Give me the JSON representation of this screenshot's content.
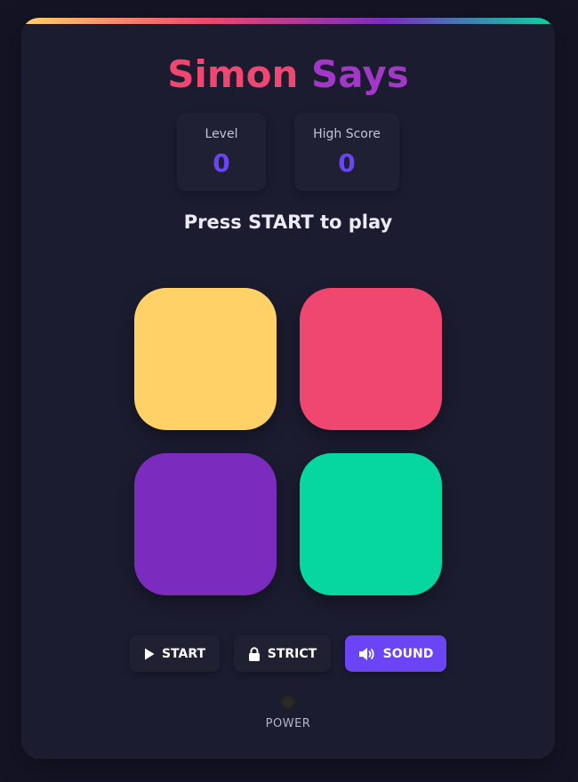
{
  "title": {
    "part1": "Simon",
    "part2": "Says"
  },
  "stats": {
    "level": {
      "label": "Level",
      "value": "0"
    },
    "high_score": {
      "label": "High Score",
      "value": "0"
    }
  },
  "message": "Press START to play",
  "pads": [
    {
      "name": "yellow",
      "color": "#ffd166"
    },
    {
      "name": "red",
      "color": "#ef476f"
    },
    {
      "name": "purple",
      "color": "#7b2cbf"
    },
    {
      "name": "green",
      "color": "#06d6a0"
    }
  ],
  "controls": {
    "start": {
      "label": "START",
      "icon": "play-icon"
    },
    "strict": {
      "label": "STRICT",
      "icon": "lock-icon"
    },
    "sound": {
      "label": "SOUND",
      "icon": "speaker-icon",
      "active": true
    }
  },
  "power": {
    "label": "POWER",
    "on": false
  },
  "colors": {
    "accent": "#6b45f5",
    "background": "#141425",
    "card": "#1b1c30"
  }
}
